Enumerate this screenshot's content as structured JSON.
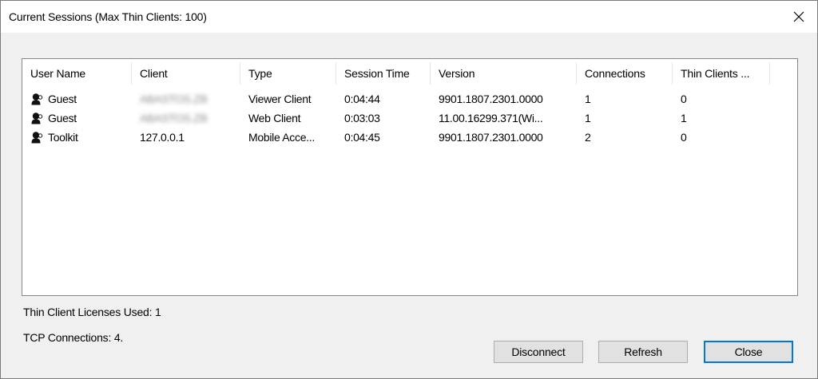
{
  "window": {
    "title": "Current Sessions (Max Thin Clients: 100)",
    "close_symbol": "✕"
  },
  "table": {
    "columns": [
      {
        "label": "User Name"
      },
      {
        "label": "Client"
      },
      {
        "label": "Type"
      },
      {
        "label": "Session Time"
      },
      {
        "label": "Version"
      },
      {
        "label": "Connections"
      },
      {
        "label": "Thin Clients ..."
      }
    ],
    "rows": [
      {
        "icon": "user-icon",
        "user": "Guest",
        "client": "ABASTOS.ZB",
        "client_obscured": true,
        "type": "Viewer Client",
        "session_time": "0:04:44",
        "version": "9901.1807.2301.0000",
        "connections": "1",
        "thin_clients": "0"
      },
      {
        "icon": "user-icon",
        "user": "Guest",
        "client": "ABASTOS.ZB",
        "client_obscured": true,
        "type": "Web Client",
        "session_time": "0:03:03",
        "version": "11.00.16299.371(Wi...",
        "connections": "1",
        "thin_clients": "1"
      },
      {
        "icon": "user-icon",
        "user": "Toolkit",
        "client": "127.0.0.1",
        "client_obscured": false,
        "type": "Mobile Acce...",
        "session_time": "0:04:45",
        "version": "9901.1807.2301.0000",
        "connections": "2",
        "thin_clients": "0"
      }
    ]
  },
  "footer": {
    "licenses_used": "Thin Client Licenses Used: 1",
    "tcp_connections": "TCP Connections: 4."
  },
  "buttons": {
    "disconnect": "Disconnect",
    "refresh": "Refresh",
    "close": "Close"
  },
  "colors": {
    "window_bg": "#f0f0f0",
    "titlebar_bg": "#ffffff",
    "default_button_border": "#0078d7"
  }
}
